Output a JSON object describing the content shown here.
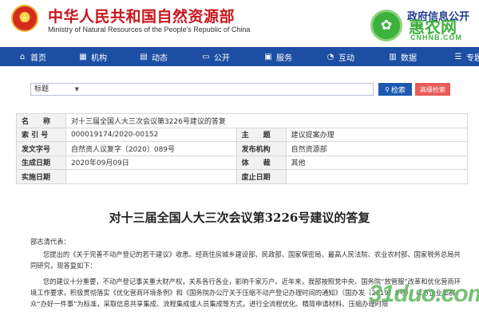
{
  "header": {
    "title": "中华人民共和国自然资源部",
    "subtitle": "Ministry of Natural Resources of the People's Republic of China",
    "gov_open": "政府信息公开"
  },
  "watermark": {
    "title": "惠农网",
    "url": "CNHNB.COM",
    "bottom": "31duo.com"
  },
  "nav": {
    "items": [
      {
        "label": "首页",
        "icon": "home-icon"
      },
      {
        "label": "机构",
        "icon": "building-icon"
      },
      {
        "label": "动态",
        "icon": "news-icon"
      },
      {
        "label": "公开",
        "icon": "screen-icon"
      },
      {
        "label": "服务",
        "icon": "briefcase-icon"
      },
      {
        "label": "互动",
        "icon": "chat-icon"
      },
      {
        "label": "数据",
        "icon": "chart-icon"
      },
      {
        "label": "专题",
        "icon": "list-icon"
      }
    ]
  },
  "search": {
    "select_value": "标题",
    "placeholder": "",
    "search_label": "检索",
    "advanced_label": "高级检索"
  },
  "meta": {
    "name_label": "名　　称",
    "name_value": "对十三届全国人大三次会议第3226号建议的答复",
    "index_label": "索 引 号",
    "index_value": "000019174/2020-00152",
    "subject_label": "主　　题",
    "subject_value": "建议提案办理",
    "docno_label": "发文字号",
    "docno_value": "自然资人议复字〔2020〕089号",
    "issuer_label": "发布机构",
    "issuer_value": "自然资源部",
    "gen_date_label": "生成日期",
    "gen_date_value": "2020年09月09日",
    "genre_label": "体　　裁",
    "genre_value": "其他",
    "impl_date_label": "实施日期",
    "impl_date_value": "",
    "expire_label": "废止日期",
    "expire_value": ""
  },
  "article": {
    "title": "对十三届全国人大三次会议第3226号建议的答复",
    "salutation": "部志清代表：",
    "p1": "您提出的《关于完善不动产登记的若干建议》收悉。经商住房城乡建设部、民政部、国家保密局、最高人民法院、农业农村部、国家税务总局共同研究，现答复如下：",
    "p2": "您的建议十分重要，不动产登记事关重大财产权，关系各行各业，影响千家万户。近年来，我部按照党中央、国务院“放管服”改革和优化营商环境工作要求，积极贯彻落实《优化营商环境条例》和《国务院办公厅关于压缩不动产登记办理时间的通知》（国办发〔2019〕8号），以方企业和群众“办好一件事”为标准，采取信息共享集成、流程集成或人员集成等方式，进行全流程优化、精简申请材料、压缩办理时限"
  },
  "colors": {
    "brand_red": "#c8161d",
    "nav_blue": "#1c4fa3",
    "search_blue": "#1c59b0",
    "advanced_red": "#e85b5b",
    "watermark_green": "#3db13d"
  }
}
